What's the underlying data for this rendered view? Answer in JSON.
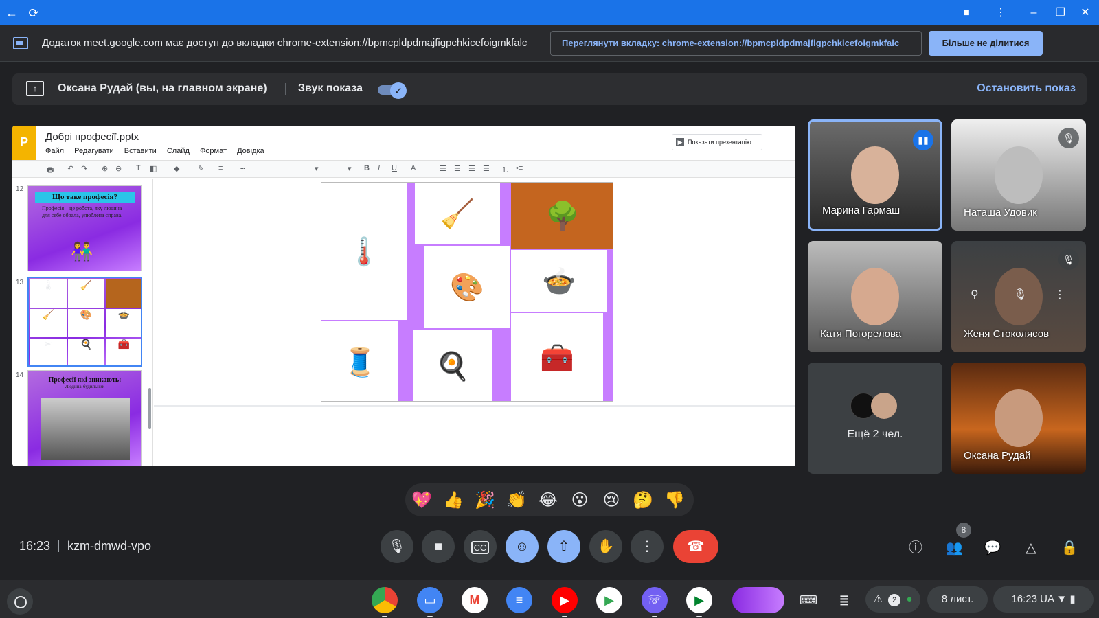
{
  "browser": {
    "back_icon": "arrow-left-icon",
    "reload_icon": "reload-icon"
  },
  "share_infobar": {
    "message": "Додаток meet.google.com має доступ до вкладки chrome-extension://bpmcpldpdmajfigpchkicefoigmkfalc",
    "view_tab_label": "Переглянути вкладку: chrome-extension://bpmcpldpdmajfigpchkicefoigmkfalc",
    "stop_sharing_label": "Більше не ділитися"
  },
  "presenting_bar": {
    "presenter": "Оксана Рудай (вы, на главном экране)",
    "sound_label": "Звук показа",
    "sound_on": true,
    "stop_label": "Остановить показ"
  },
  "slides_app": {
    "logo_letter": "P",
    "filename": "Добрі професії.pptx",
    "menu": [
      "Файл",
      "Редагувати",
      "Вставити",
      "Слайд",
      "Формат",
      "Довідка"
    ],
    "present_label": "Показати презентацію",
    "slides": [
      {
        "number": "12",
        "title": "Що таке професія?",
        "body": "Професія – це робота, яку людина для себе обрала, улюблена справа."
      },
      {
        "number": "13",
        "title": "",
        "body": ""
      },
      {
        "number": "14",
        "title": "Професії які зникають:",
        "body": "Людина-будильник"
      }
    ]
  },
  "participants": [
    {
      "name": "Марина Гармаш",
      "status": "speaking"
    },
    {
      "name": "Наташа Удовик",
      "status": "muted"
    },
    {
      "name": "Катя Погорелова",
      "status": ""
    },
    {
      "name": "Женя Стоколясов",
      "status": "muted"
    },
    {
      "name": "Ещё 2 чел.",
      "status": ""
    },
    {
      "name": "Оксана Рудай",
      "status": ""
    }
  ],
  "reactions": [
    "💖",
    "👍",
    "🎉",
    "👏",
    "😂",
    "😮",
    "😢",
    "🤔",
    "👎"
  ],
  "meeting": {
    "time": "16:23",
    "code": "kzm-dmwd-vpo",
    "people_count": "8"
  },
  "shelf": {
    "date": "8 лист.",
    "clock": "16:23",
    "locale": "UA",
    "notifications": "2"
  },
  "colors": {
    "accent": "#1a73e8",
    "light_accent": "#8ab4f8",
    "end_call": "#ea4335",
    "background": "#202124"
  }
}
